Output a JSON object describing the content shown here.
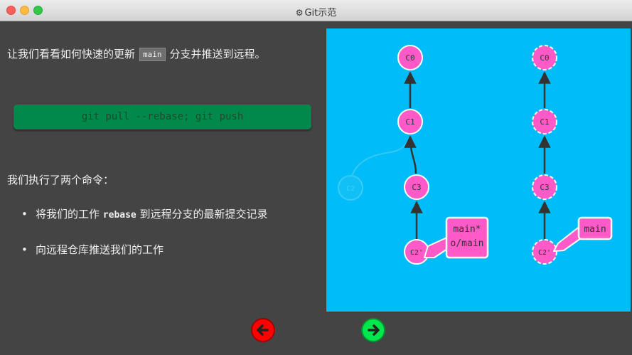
{
  "window": {
    "title": "Git示范",
    "title_icon": "gear-icon"
  },
  "content": {
    "intro_before": "让我们看看如何快速的更新",
    "intro_code": "main",
    "intro_after": "分支并推送到远程。",
    "command": "git pull --rebase; git push",
    "paragraph": "我们执行了两个命令：",
    "bullet1_before": "将我们的工作",
    "bullet1_code": "rebase",
    "bullet1_after": "到远程分支的最新提交记录",
    "bullet2": "向远程仓库推送我们的工作"
  },
  "graph": {
    "colors": {
      "background": "#00bcf8",
      "commit": "#ff5ac8",
      "edge": "#333333",
      "ghost": "#1fc3f5"
    },
    "local": {
      "commits": [
        "C0",
        "C1",
        "C3",
        "C2'"
      ],
      "ghost_commit": "C2",
      "labels": [
        "main*",
        "o/main"
      ]
    },
    "remote": {
      "commits": [
        "C0",
        "C1",
        "C3",
        "C2'"
      ],
      "labels": [
        "main"
      ]
    }
  },
  "nav": {
    "back_icon": "arrow-left-icon",
    "next_icon": "arrow-right-icon"
  }
}
